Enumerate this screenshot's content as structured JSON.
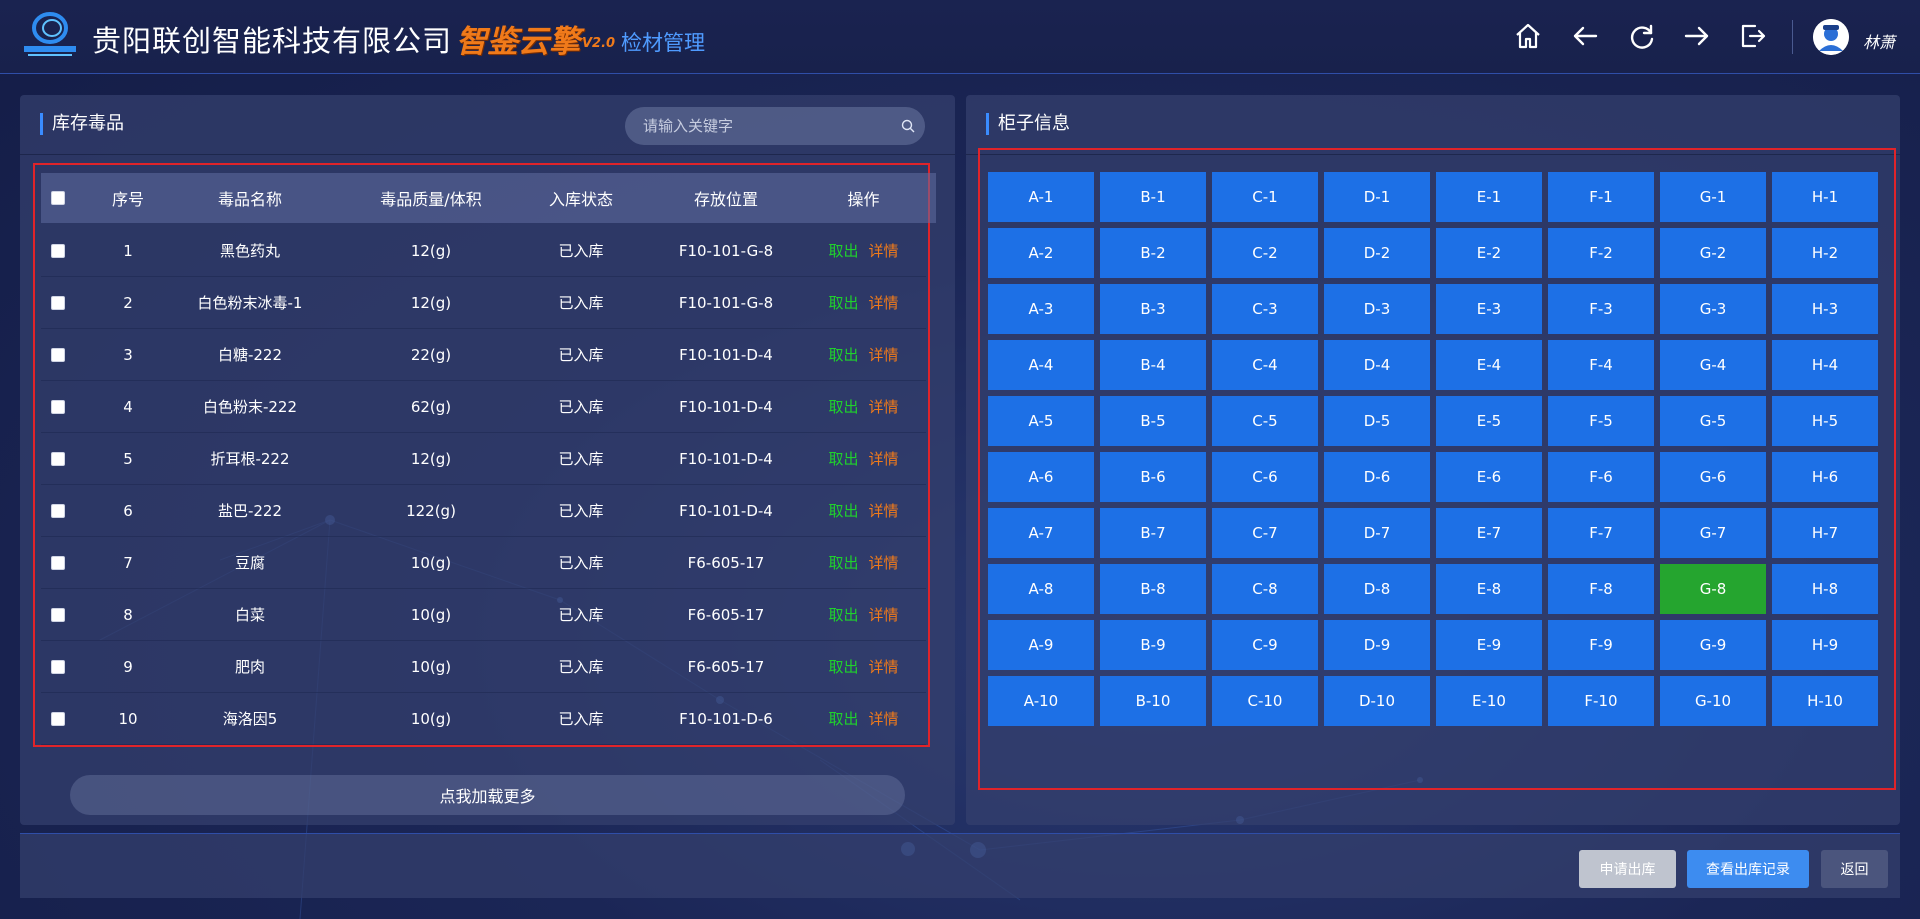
{
  "header": {
    "company": "贵阳联创智能科技有限公司",
    "brand": "智鉴云擎",
    "version": "V2.0",
    "module": "检材管理",
    "user": "林萧",
    "icons": [
      "home-icon",
      "back-icon",
      "refresh-icon",
      "forward-icon",
      "logout-icon"
    ]
  },
  "inventory": {
    "title": "库存毒品",
    "search_placeholder": "请输入关键字",
    "columns": {
      "index": "序号",
      "name": "毒品名称",
      "qty": "毒品质量/体积",
      "status": "入库状态",
      "location": "存放位置",
      "ops": "操作"
    },
    "op_take": "取出",
    "op_detail": "详情",
    "rows": [
      {
        "index": "1",
        "name": "黑色药丸",
        "qty": "12(g)",
        "status": "已入库",
        "location": "F10-101-G-8"
      },
      {
        "index": "2",
        "name": "白色粉末冰毒-1",
        "qty": "12(g)",
        "status": "已入库",
        "location": "F10-101-G-8"
      },
      {
        "index": "3",
        "name": "白糖-222",
        "qty": "22(g)",
        "status": "已入库",
        "location": "F10-101-D-4"
      },
      {
        "index": "4",
        "name": "白色粉末-222",
        "qty": "62(g)",
        "status": "已入库",
        "location": "F10-101-D-4"
      },
      {
        "index": "5",
        "name": "折耳根-222",
        "qty": "12(g)",
        "status": "已入库",
        "location": "F10-101-D-4"
      },
      {
        "index": "6",
        "name": "盐巴-222",
        "qty": "122(g)",
        "status": "已入库",
        "location": "F10-101-D-4"
      },
      {
        "index": "7",
        "name": "豆腐",
        "qty": "10(g)",
        "status": "已入库",
        "location": "F6-605-17"
      },
      {
        "index": "8",
        "name": "白菜",
        "qty": "10(g)",
        "status": "已入库",
        "location": "F6-605-17"
      },
      {
        "index": "9",
        "name": "肥肉",
        "qty": "10(g)",
        "status": "已入库",
        "location": "F6-605-17"
      },
      {
        "index": "10",
        "name": "海洛因5",
        "qty": "10(g)",
        "status": "已入库",
        "location": "F10-101-D-6"
      }
    ],
    "load_more": "点我加载更多"
  },
  "cabinet": {
    "title": "柜子信息",
    "columns": [
      "A",
      "B",
      "C",
      "D",
      "E",
      "F",
      "G",
      "H"
    ],
    "rows": 10,
    "active": "G-8",
    "colors": {
      "normal": "#1d70e6",
      "active": "#25a52f"
    }
  },
  "footer": {
    "apply": "申请出库",
    "records": "查看出库记录",
    "back": "返回"
  }
}
